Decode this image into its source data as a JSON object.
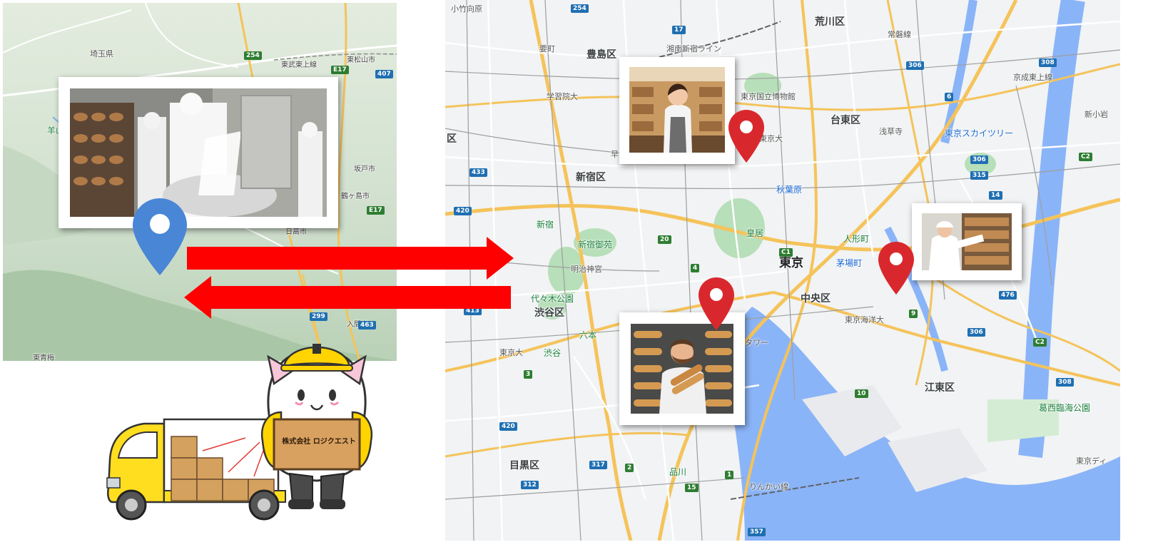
{
  "left_map": {
    "labels": {
      "saitama": "埼玉県",
      "higashimatsuyama": "東松山市",
      "tobutojo": "東武東上線",
      "sakado": "坂戸市",
      "tsurugashima": "鶴ヶ島市",
      "hidaka": "日高市",
      "iruma": "入間市",
      "ohme": "東青梅",
      "hanno": "羊山"
    },
    "shields": [
      "254",
      "E17",
      "407",
      "E17",
      "299",
      "463"
    ]
  },
  "right_map": {
    "districts": {
      "toshima": "豊島区",
      "arakawa": "荒川区",
      "taito": "台東区",
      "shinjuku": "新宿区",
      "shibuya": "渋谷区",
      "chuo": "中央区",
      "koto": "江東区",
      "meguro": "目黒区",
      "tokyo": "東京"
    },
    "places": {
      "gakushuin": "学習院大",
      "natmuseum": "東京国立博物館",
      "todai": "東京大",
      "asakusa": "浅草寺",
      "skytree": "東京スカイツリー",
      "akihabara": "秋葉原",
      "kokyo": "皇居",
      "shinjukugyoen": "新宿御苑",
      "meijijingu": "明治神宮",
      "yoyogi": "代々木公園",
      "shinjukust": "新宿",
      "shibuyast": "渋谷",
      "ningyocho": "人形町",
      "kayabacho": "茅場町",
      "kaiyodai": "東京海洋大",
      "tower": "タワー",
      "roppongi": "六本",
      "tokyodai": "東京大",
      "shinagawa": "品川",
      "rinkai": "りんかい線",
      "kasai": "葛西臨海公園",
      "shinkoiwa": "新小岩",
      "komagome": "小竹向原",
      "kaname": "要町",
      "keiyo": "京成東上線",
      "shinjukuline": "湘南新宿ライン",
      "joban": "常磐線",
      "tokyodi": "東京ディ",
      "ku": "区",
      "haya": "早"
    },
    "shields": [
      "254",
      "17",
      "306",
      "433",
      "420",
      "413",
      "476",
      "306",
      "315",
      "308",
      "C2",
      "C2",
      "C1",
      "308",
      "306",
      "420",
      "317",
      "312",
      "357",
      "14",
      "20",
      "4",
      "3",
      "10",
      "9",
      "6",
      "2",
      "1",
      "15"
    ]
  },
  "mascot": {
    "box_label": "株式会社 ロジクエスト"
  }
}
